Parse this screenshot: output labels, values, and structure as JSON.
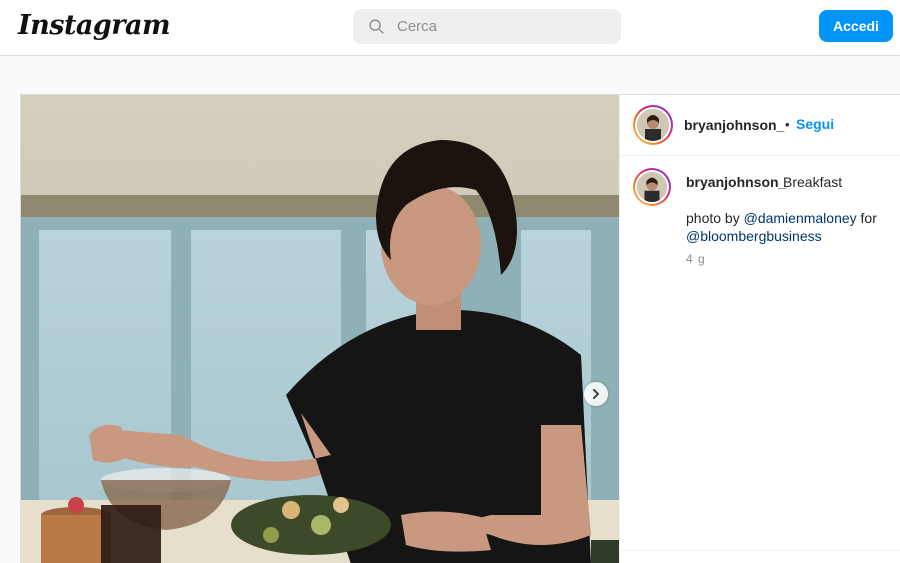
{
  "header": {
    "logo": "Instagram",
    "search_placeholder": "Cerca",
    "login_label": "Accedi",
    "accent_color": "#0095f6"
  },
  "post": {
    "username": "bryanjohnson_",
    "separator": "•",
    "follow_label": "Segui",
    "caption": "Breakfast",
    "credit_prefix": "photo by ",
    "credit_mention_1": "@damienmaloney",
    "credit_middle": " for ",
    "credit_mention_2": "@bloombergbusiness",
    "time_ago": "4 g",
    "icons": [
      "search-icon",
      "chevron-right-icon"
    ]
  }
}
